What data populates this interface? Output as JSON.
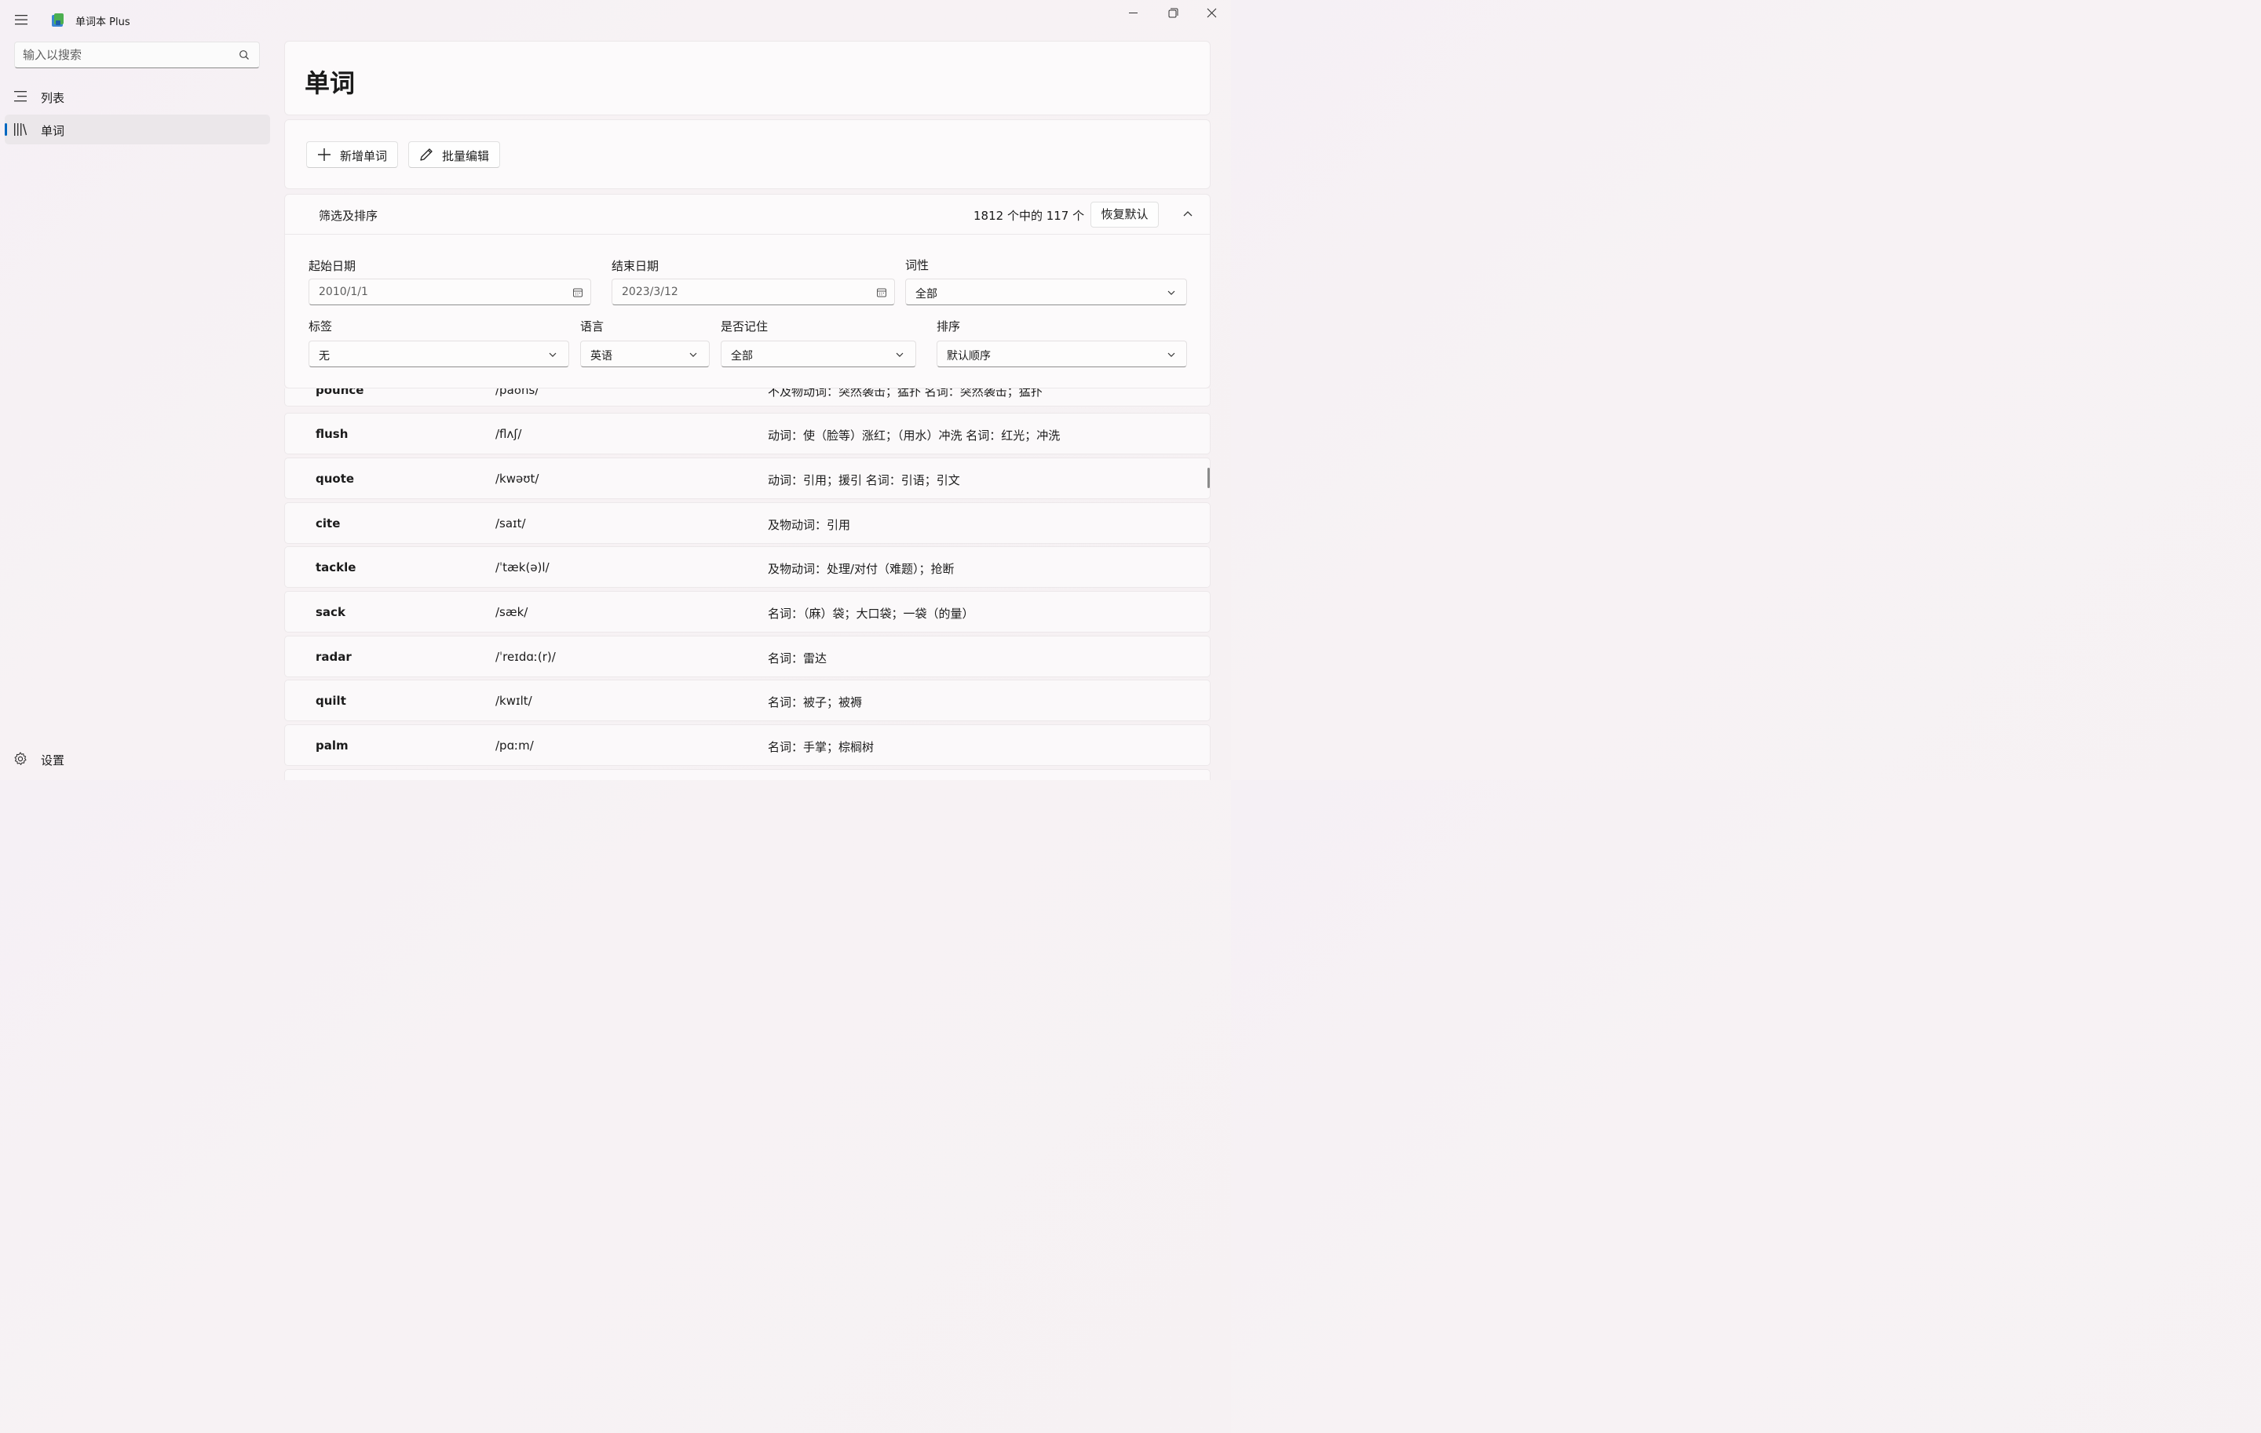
{
  "app": {
    "title": "单词本 Plus",
    "accent": "#0067c0"
  },
  "sidebar": {
    "search_placeholder": "输入以搜索",
    "items": [
      {
        "label": "列表",
        "icon": "list-icon"
      },
      {
        "label": "单词",
        "icon": "library-icon",
        "selected": true
      }
    ],
    "settings_label": "设置"
  },
  "page": {
    "title": "单词"
  },
  "toolbar": {
    "add_label": "新增单词",
    "batch_label": "批量编辑"
  },
  "filter": {
    "header": "筛选及排序",
    "count": "1812 个中的 117 个",
    "reset_label": "恢复默认",
    "start_date_label": "起始日期",
    "start_date_value": "2010/1/1",
    "end_date_label": "结束日期",
    "end_date_value": "2023/3/12",
    "pos_label": "词性",
    "pos_value": "全部",
    "tag_label": "标签",
    "tag_value": "无",
    "language_label": "语言",
    "language_value": "英语",
    "memorized_label": "是否记住",
    "memorized_value": "全部",
    "sort_label": "排序",
    "sort_value": "默认顺序"
  },
  "words": [
    {
      "word": "pounce",
      "phonetic": "/paʊns/",
      "meaning": "不及物动词：突然袭击；猛扑 名词：突然袭击；猛扑"
    },
    {
      "word": "flush",
      "phonetic": "/flʌʃ/",
      "meaning": "动词：使（脸等）涨红；（用水）冲洗 名词：红光；冲洗"
    },
    {
      "word": "quote",
      "phonetic": "/kwəʊt/",
      "meaning": "动词：引用；援引 名词：引语；引文"
    },
    {
      "word": "cite",
      "phonetic": "/saɪt/",
      "meaning": "及物动词：引用"
    },
    {
      "word": "tackle",
      "phonetic": "/ˈtæk(ə)l/",
      "meaning": "及物动词：处理/对付（难题）；抢断"
    },
    {
      "word": "sack",
      "phonetic": "/sæk/",
      "meaning": "名词：（麻）袋；大口袋；一袋（的量）"
    },
    {
      "word": "radar",
      "phonetic": "/ˈreɪdɑː(r)/",
      "meaning": "名词：雷达"
    },
    {
      "word": "quilt",
      "phonetic": "/kwɪlt/",
      "meaning": "名词：被子；被褥"
    },
    {
      "word": "palm",
      "phonetic": "/pɑːm/",
      "meaning": "名词：手掌；棕榈树"
    }
  ]
}
